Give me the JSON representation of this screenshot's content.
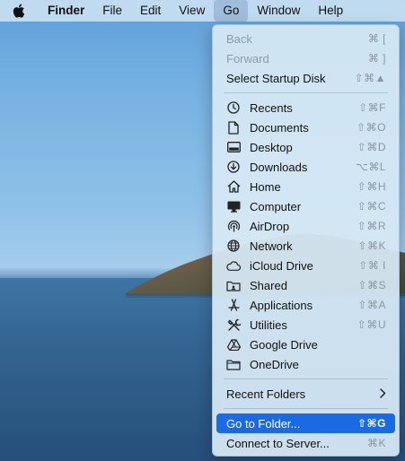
{
  "menubar": {
    "items": [
      {
        "label": "Finder"
      },
      {
        "label": "File"
      },
      {
        "label": "Edit"
      },
      {
        "label": "View"
      },
      {
        "label": "Go"
      },
      {
        "label": "Window"
      },
      {
        "label": "Help"
      }
    ]
  },
  "go_menu": {
    "history": [
      {
        "label": "Back",
        "shortcut": "⌘ [",
        "enabled": false
      },
      {
        "label": "Forward",
        "shortcut": "⌘ ]",
        "enabled": false
      },
      {
        "label": "Select Startup Disk",
        "shortcut": "⇧⌘▲",
        "enabled": true
      }
    ],
    "places": [
      {
        "label": "Recents",
        "shortcut": "⇧⌘F",
        "icon": "clock-icon"
      },
      {
        "label": "Documents",
        "shortcut": "⇧⌘O",
        "icon": "document-icon"
      },
      {
        "label": "Desktop",
        "shortcut": "⇧⌘D",
        "icon": "desktop-icon"
      },
      {
        "label": "Downloads",
        "shortcut": "⌥⌘L",
        "icon": "download-icon"
      },
      {
        "label": "Home",
        "shortcut": "⇧⌘H",
        "icon": "home-icon"
      },
      {
        "label": "Computer",
        "shortcut": "⇧⌘C",
        "icon": "computer-icon"
      },
      {
        "label": "AirDrop",
        "shortcut": "⇧⌘R",
        "icon": "airdrop-icon"
      },
      {
        "label": "Network",
        "shortcut": "⇧⌘K",
        "icon": "globe-icon"
      },
      {
        "label": "iCloud Drive",
        "shortcut": "⇧⌘ I",
        "icon": "cloud-icon"
      },
      {
        "label": "Shared",
        "shortcut": "⇧⌘S",
        "icon": "shared-folder-icon"
      },
      {
        "label": "Applications",
        "shortcut": "⇧⌘A",
        "icon": "applications-icon"
      },
      {
        "label": "Utilities",
        "shortcut": "⇧⌘U",
        "icon": "utilities-icon"
      },
      {
        "label": "Google Drive",
        "shortcut": "",
        "icon": "google-drive-icon"
      },
      {
        "label": "OneDrive",
        "shortcut": "",
        "icon": "folder-icon"
      }
    ],
    "recent_folders": {
      "label": "Recent Folders",
      "submenu_icon": "chevron-right-icon"
    },
    "goto": [
      {
        "label": "Go to Folder...",
        "shortcut": "⇧⌘G",
        "highlighted": true
      },
      {
        "label": "Connect to Server...",
        "shortcut": "⌘K",
        "highlighted": false
      }
    ]
  }
}
